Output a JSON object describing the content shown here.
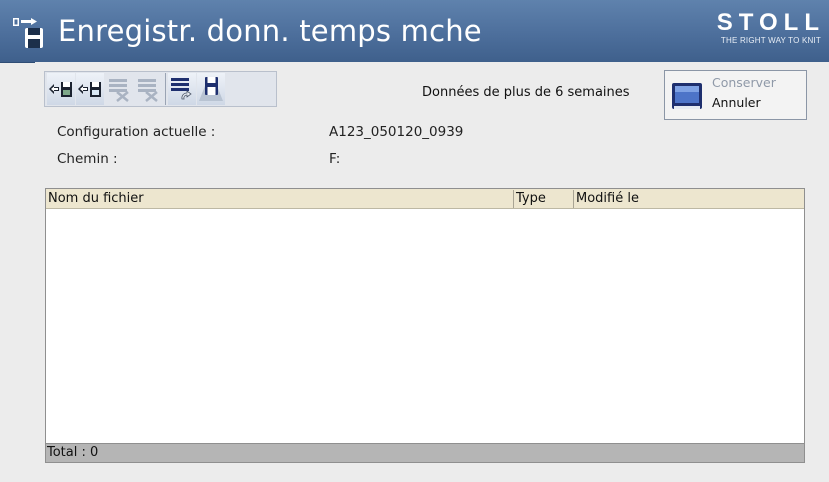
{
  "window": {
    "title": "Enregistr. donn. temps mche",
    "brand": "STOLL",
    "brand_tagline": "THE RIGHT WAY TO KNIT",
    "icon": "data-record-icon"
  },
  "colors": {
    "titlebar": "#4d6f9c",
    "toolbar_background": "#e1e5ec",
    "table_header": "#ede6cf",
    "table_footer": "#b5b5b5"
  },
  "toolbar": {
    "buttons": [
      {
        "name": "import-icon",
        "enabled": true
      },
      {
        "name": "export-icon",
        "enabled": true
      },
      {
        "name": "delete-row-icon",
        "enabled": false
      },
      {
        "name": "delete-all-icon",
        "enabled": false
      },
      {
        "name": "refresh-list-icon",
        "enabled": true
      },
      {
        "name": "save-data-icon",
        "enabled": true
      }
    ]
  },
  "old_data": {
    "label": "Données de plus de 6 semaines",
    "keep_label": "Conserver",
    "cancel_label": "Annuler"
  },
  "info": {
    "config_label": "Configuration actuelle :",
    "config_value": "A123_050120_0939",
    "path_label": "Chemin :",
    "path_value": "F:"
  },
  "table": {
    "columns": [
      "Nom du fichier",
      "Type",
      "Modifié le"
    ],
    "rows": [],
    "total": "Total : 0"
  }
}
